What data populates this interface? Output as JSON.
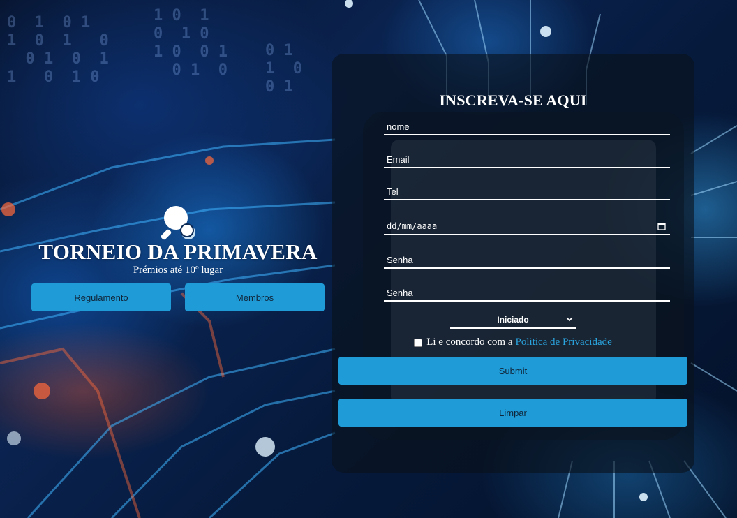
{
  "hero": {
    "title": "TORNEIO DA PRIMAVERA",
    "subtitle": "Prémios até 10º lugar",
    "icon": "ping-pong-paddle-icon",
    "buttons": {
      "regulamento": "Regulamento",
      "membros": "Membros"
    }
  },
  "form": {
    "title": "INSCREVA-SE AQUI",
    "fields": {
      "nome": "nome",
      "email": "Email",
      "tel": "Tel",
      "date": "dd/mm/aaaa",
      "senha": "Senha",
      "senha_confirm": "Senha"
    },
    "level_select": {
      "selected": "Iniciado"
    },
    "consent": {
      "text": "Li e concordo com a",
      "link": "Politica de Privacidade"
    },
    "submit_label": "Submit",
    "clear_label": "Limpar"
  },
  "colors": {
    "accent": "#1f9bd7",
    "link": "#2aa5e0",
    "panel": "rgba(10,18,28,0.62)"
  }
}
